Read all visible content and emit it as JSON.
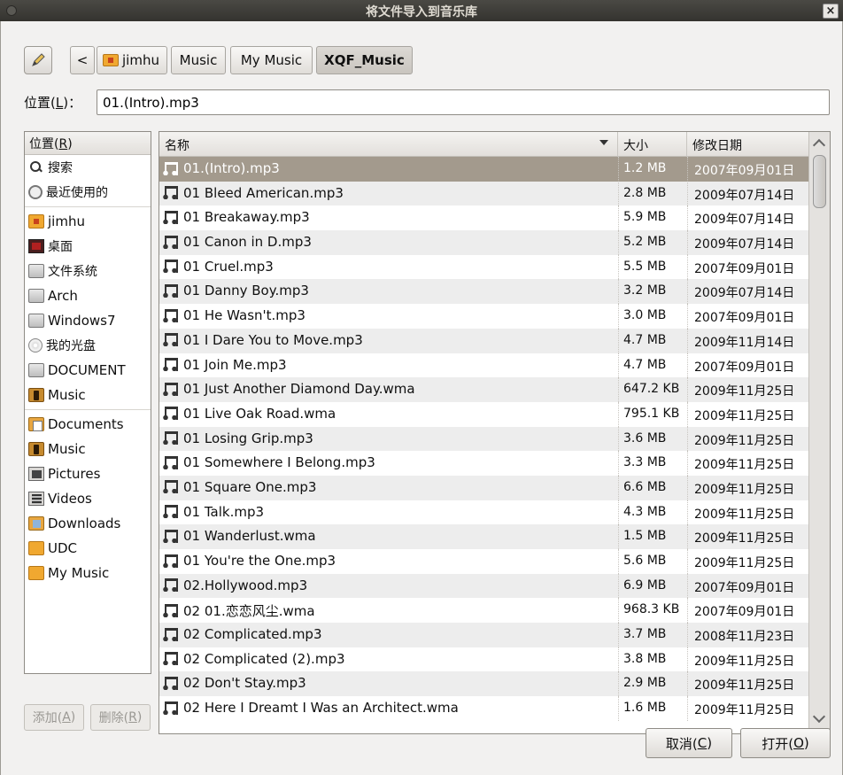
{
  "window": {
    "title": "将文件导入到音乐库",
    "close_glyph": "×"
  },
  "pathbar": {
    "back_glyph": "<",
    "crumbs": [
      "jimhu",
      "Music",
      "My Music",
      "XQF_Music"
    ]
  },
  "location": {
    "label": "位置(L)：",
    "value": "01.(Intro).mp3"
  },
  "places": {
    "header": "位置(R)",
    "items": [
      {
        "label": "搜索",
        "icon": "search-icon"
      },
      {
        "label": "最近使用的",
        "icon": "recent-icon"
      },
      {
        "label": "jimhu",
        "icon": "home-folder-icon"
      },
      {
        "label": "桌面",
        "icon": "desktop-icon"
      },
      {
        "label": "文件系统",
        "icon": "drive-icon"
      },
      {
        "label": "Arch",
        "icon": "drive-icon"
      },
      {
        "label": "Windows7",
        "icon": "drive-icon"
      },
      {
        "label": "我的光盘",
        "icon": "cd-icon"
      },
      {
        "label": "DOCUMENT",
        "icon": "drive-icon"
      },
      {
        "label": "Music",
        "icon": "music-folder-icon"
      },
      {
        "label": "Documents",
        "icon": "documents-folder-icon"
      },
      {
        "label": "Music",
        "icon": "music-folder-icon"
      },
      {
        "label": "Pictures",
        "icon": "pictures-folder-icon"
      },
      {
        "label": "Videos",
        "icon": "videos-folder-icon"
      },
      {
        "label": "Downloads",
        "icon": "downloads-folder-icon"
      },
      {
        "label": "UDC",
        "icon": "folder-icon"
      },
      {
        "label": "My Music",
        "icon": "folder-icon"
      }
    ],
    "add_label": "添加(A)",
    "remove_label": "删除(R)"
  },
  "files": {
    "columns": {
      "name": "名称",
      "size": "大小",
      "date": "修改日期"
    },
    "rows": [
      {
        "name": "01.(Intro).mp3",
        "size": "1.2 MB",
        "date": "2007年09月01日"
      },
      {
        "name": "01 Bleed American.mp3",
        "size": "2.8 MB",
        "date": "2009年07月14日"
      },
      {
        "name": "01 Breakaway.mp3",
        "size": "5.9 MB",
        "date": "2009年07月14日"
      },
      {
        "name": "01 Canon in D.mp3",
        "size": "5.2 MB",
        "date": "2009年07月14日"
      },
      {
        "name": "01 Cruel.mp3",
        "size": "5.5 MB",
        "date": "2007年09月01日"
      },
      {
        "name": "01 Danny Boy.mp3",
        "size": "3.2 MB",
        "date": "2009年07月14日"
      },
      {
        "name": "01 He Wasn't.mp3",
        "size": "3.0 MB",
        "date": "2007年09月01日"
      },
      {
        "name": "01 I Dare You to Move.mp3",
        "size": "4.7 MB",
        "date": "2009年11月14日"
      },
      {
        "name": "01 Join Me.mp3",
        "size": "4.7 MB",
        "date": "2007年09月01日"
      },
      {
        "name": "01 Just Another Diamond Day.wma",
        "size": "647.2 KB",
        "date": "2009年11月25日"
      },
      {
        "name": "01 Live Oak Road.wma",
        "size": "795.1 KB",
        "date": "2009年11月25日"
      },
      {
        "name": "01 Losing Grip.mp3",
        "size": "3.6 MB",
        "date": "2009年11月25日"
      },
      {
        "name": "01 Somewhere I Belong.mp3",
        "size": "3.3 MB",
        "date": "2009年11月25日"
      },
      {
        "name": "01 Square One.mp3",
        "size": "6.6 MB",
        "date": "2009年11月25日"
      },
      {
        "name": "01 Talk.mp3",
        "size": "4.3 MB",
        "date": "2009年11月25日"
      },
      {
        "name": "01 Wanderlust.wma",
        "size": "1.5 MB",
        "date": "2009年11月25日"
      },
      {
        "name": "01 You're the One.mp3",
        "size": "5.6 MB",
        "date": "2009年11月25日"
      },
      {
        "name": "02.Hollywood.mp3",
        "size": "6.9 MB",
        "date": "2007年09月01日"
      },
      {
        "name": "02 01.恋恋风尘.wma",
        "size": "968.3 KB",
        "date": "2007年09月01日"
      },
      {
        "name": "02 Complicated.mp3",
        "size": "3.7 MB",
        "date": "2008年11月23日"
      },
      {
        "name": "02 Complicated (2).mp3",
        "size": "3.8 MB",
        "date": "2009年11月25日"
      },
      {
        "name": "02 Don't Stay.mp3",
        "size": "2.9 MB",
        "date": "2009年11月25日"
      },
      {
        "name": "02 Here I Dreamt I Was an Architect.wma",
        "size": "1.6 MB",
        "date": "2009年11月25日"
      }
    ]
  },
  "buttons": {
    "cancel": "取消(C)",
    "open": "打开(O)"
  },
  "colors": {
    "selected_row": "#a39a8d",
    "titlebar": "#3c3b37"
  }
}
